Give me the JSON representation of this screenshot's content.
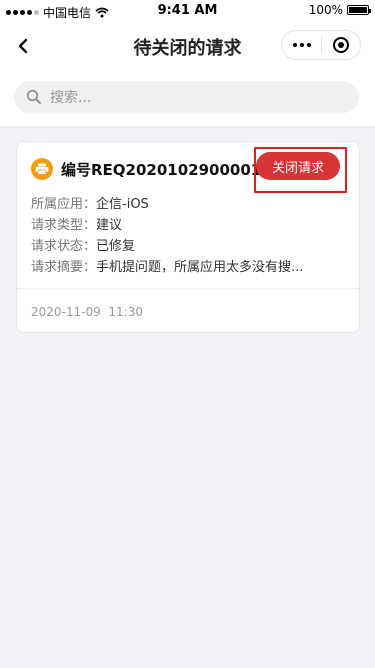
{
  "status_bar": {
    "carrier": "中国电信",
    "time": "9:41 AM",
    "battery": "100%"
  },
  "nav": {
    "title": "待关闭的请求"
  },
  "search": {
    "placeholder": "搜索..."
  },
  "request": {
    "title": "编号REQ2020102900001",
    "fields": [
      {
        "label": "所属应用：",
        "value": "企信-iOS"
      },
      {
        "label": "请求类型：",
        "value": "建议"
      },
      {
        "label": "请求状态：",
        "value": "已修复"
      },
      {
        "label": "请求摘要：",
        "value": "手机提问题，所属应用太多没有搜..."
      }
    ],
    "date": "2020-11-09",
    "time": "11:30",
    "close_label": "关闭请求"
  }
}
